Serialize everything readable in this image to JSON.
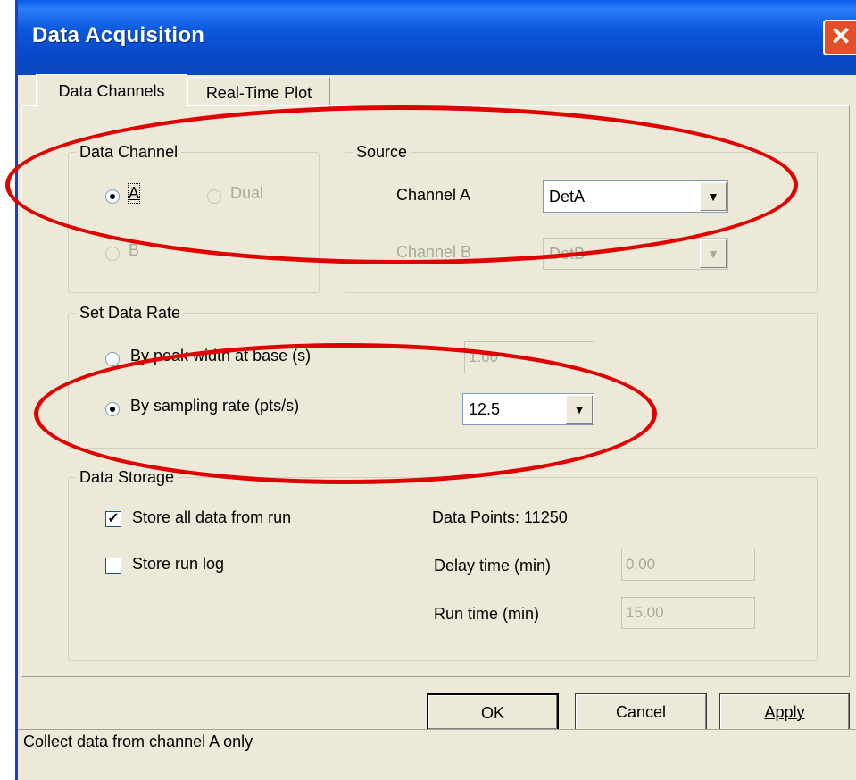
{
  "window": {
    "title": "Data Acquisition",
    "close_icon": "close-icon"
  },
  "tabs": [
    {
      "label": "Data Channels",
      "active": true
    },
    {
      "label": "Real-Time Plot",
      "active": false
    }
  ],
  "data_channel": {
    "legend": "Data Channel",
    "options": [
      {
        "label": "A",
        "selected": true,
        "enabled": true
      },
      {
        "label": "Dual",
        "selected": false,
        "enabled": false
      },
      {
        "label": "B",
        "selected": false,
        "enabled": false
      }
    ]
  },
  "source": {
    "legend": "Source",
    "channel_a_label": "Channel A",
    "channel_a_value": "DetA",
    "channel_b_label": "Channel B",
    "channel_b_value": "DetB"
  },
  "data_rate": {
    "legend": "Set Data Rate",
    "peak_label": "By peak width at base (s)",
    "peak_value": "1.60",
    "sampling_label": "By sampling rate (pts/s)",
    "sampling_value": "12.5",
    "selected": "sampling"
  },
  "data_storage": {
    "legend": "Data Storage",
    "store_all_label": "Store all data from run",
    "store_all_checked": true,
    "store_log_label": "Store run log",
    "store_log_checked": false,
    "data_points": "Data Points: 11250",
    "delay_label": "Delay time (min)",
    "delay_value": "0.00",
    "run_label": "Run time (min)",
    "run_value": "15.00"
  },
  "buttons": {
    "ok": "OK",
    "cancel": "Cancel",
    "apply": "Apply"
  },
  "status": "Collect data from channel A only",
  "annotation_color": "#e10000"
}
